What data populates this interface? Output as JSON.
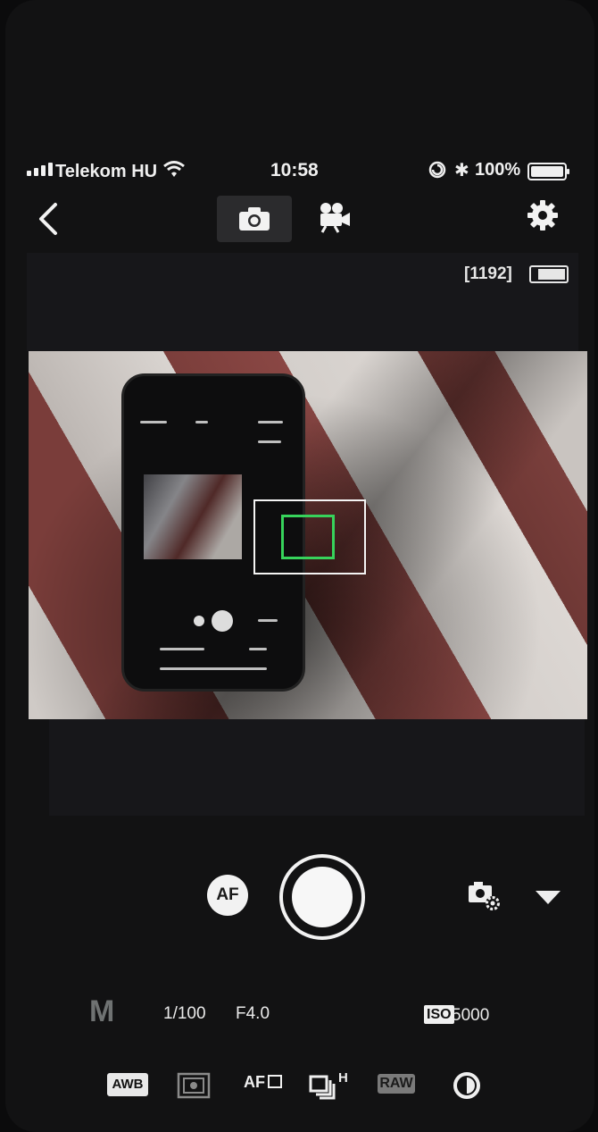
{
  "status_bar": {
    "carrier": "Telekom HU",
    "time": "10:58",
    "battery_percent": "100%"
  },
  "toolbar": {
    "icons": [
      "back-chevron-icon",
      "photo-mode-icon",
      "video-mode-icon",
      "gear-icon"
    ],
    "active_mode": "photo"
  },
  "viewfinder": {
    "shots_remaining": "[1192]",
    "camera_battery": "full",
    "focus_box_color": "#37d35b"
  },
  "controls": {
    "af_label": "AF",
    "mode": "M",
    "shutter_speed": "1/100",
    "aperture": "F4.0",
    "iso_label": "ISO",
    "iso_value": "5000"
  },
  "bottom_bar": {
    "awb": "AWB",
    "af_mode": "AF",
    "drive_suffix": "H",
    "raw": "RAW",
    "icons": [
      "awb-icon",
      "metering-icon",
      "af-area-icon",
      "continuous-drive-icon",
      "raw-icon",
      "shadow-tone-icon"
    ]
  },
  "colors": {
    "background": "#121213",
    "accent_green": "#37d35b"
  }
}
